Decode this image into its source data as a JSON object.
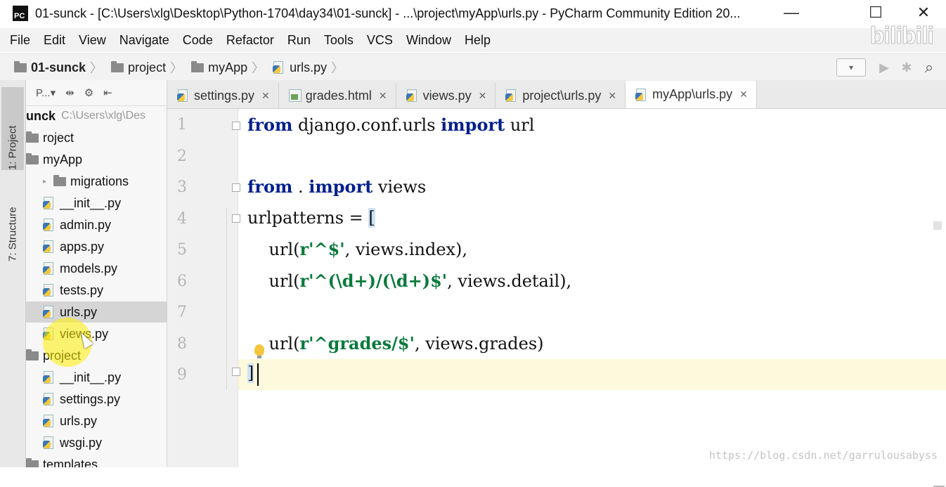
{
  "titlebar": {
    "logo_text": "PC",
    "title": "01-sunck - [C:\\Users\\xlg\\Desktop\\Python-1704\\day34\\01-sunck] - ...\\project\\myApp\\urls.py - PyCharm Community Edition 20...",
    "minimize": "—",
    "maximize": "☐",
    "close": "✕"
  },
  "menubar": {
    "items": [
      "File",
      "Edit",
      "View",
      "Navigate",
      "Code",
      "Refactor",
      "Run",
      "Tools",
      "VCS",
      "Window",
      "Help"
    ]
  },
  "navbar": {
    "breadcrumbs": [
      "01-sunck",
      "project",
      "myApp",
      "urls.py"
    ]
  },
  "sidestrip": {
    "project_tab": "1: Project",
    "structure_tab": "7: Structure"
  },
  "project_panel": {
    "toolbar_label": "P...▾",
    "tree": [
      {
        "label": "unck",
        "meta": "C:\\Users\\xlg\\Des",
        "kind": "root"
      },
      {
        "label": "roject",
        "kind": "folder"
      },
      {
        "label": "myApp",
        "kind": "folder"
      },
      {
        "label": "migrations",
        "kind": "folder"
      },
      {
        "label": "__init__.py",
        "kind": "py"
      },
      {
        "label": "admin.py",
        "kind": "py"
      },
      {
        "label": "apps.py",
        "kind": "py"
      },
      {
        "label": "models.py",
        "kind": "py"
      },
      {
        "label": "tests.py",
        "kind": "py"
      },
      {
        "label": "urls.py",
        "kind": "py",
        "selected": true
      },
      {
        "label": "views.py",
        "kind": "py"
      },
      {
        "label": "project",
        "kind": "folder"
      },
      {
        "label": "__init__.py",
        "kind": "py"
      },
      {
        "label": "settings.py",
        "kind": "py"
      },
      {
        "label": "urls.py",
        "kind": "py"
      },
      {
        "label": "wsgi.py",
        "kind": "py"
      },
      {
        "label": "templates",
        "kind": "folder"
      }
    ]
  },
  "tabs": [
    {
      "label": "settings.py",
      "kind": "py"
    },
    {
      "label": "grades.html",
      "kind": "html"
    },
    {
      "label": "views.py",
      "kind": "py"
    },
    {
      "label": "project\\urls.py",
      "kind": "py"
    },
    {
      "label": "myApp\\urls.py",
      "kind": "py",
      "active": true
    }
  ],
  "editor": {
    "line_numbers": [
      "1",
      "2",
      "3",
      "4",
      "5",
      "6",
      "7",
      "8",
      "9"
    ],
    "lines": {
      "l1_kw1": "from",
      "l1_mid": " django.conf.urls ",
      "l1_kw2": "import",
      "l1_end": " url",
      "l3_kw1": "from",
      "l3_mid": " . ",
      "l3_kw2": "import",
      "l3_end": " views",
      "l4_a": "urlpatterns = ",
      "l4_bracket": "[",
      "l5_a": "    url(",
      "l5_str": "r'^$'",
      "l5_b": ", views.index),",
      "l6_a": "    url(",
      "l6_str": "r'^(\\d+)/(\\d+)$'",
      "l6_b": ", views.detail),",
      "l8_a": "    url(",
      "l8_str": "r'^grades/$'",
      "l8_b": ", views.grades)",
      "l9_bracket": "]"
    }
  },
  "watermarks": {
    "bilibili": "bilibili",
    "csdn": "https://blog.csdn.net/garrulousabyss"
  }
}
